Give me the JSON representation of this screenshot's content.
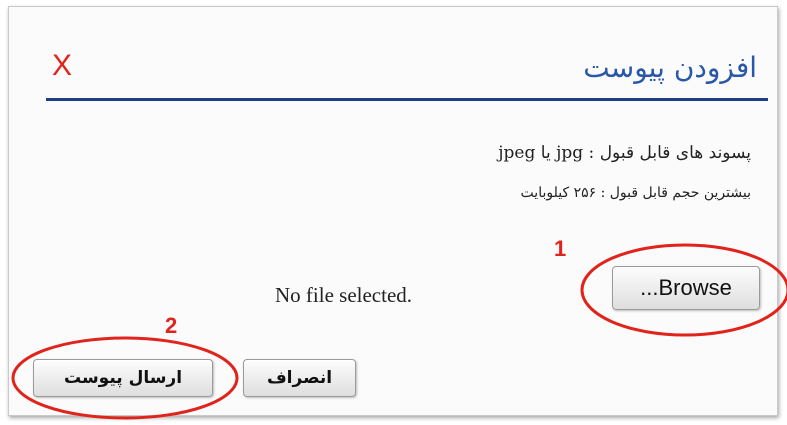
{
  "dialog": {
    "title": "افزودن پیوست",
    "close_label": "X",
    "allowed_extensions": "پسوند های قابل قبول : jpg یا jpeg",
    "max_size": "بیشترین حجم قابل قبول : ۲۵۶ کیلوبایت",
    "file_status": "No file selected.",
    "browse_label": "...Browse",
    "cancel_label": "انصراف",
    "submit_label": "ارسال پیوست"
  },
  "annotations": {
    "marker_1": "1",
    "marker_2": "2",
    "highlight_color": "#e0241c"
  },
  "colors": {
    "title": "#2a57a8",
    "rule": "#1f3f84",
    "close": "#e0241c"
  }
}
